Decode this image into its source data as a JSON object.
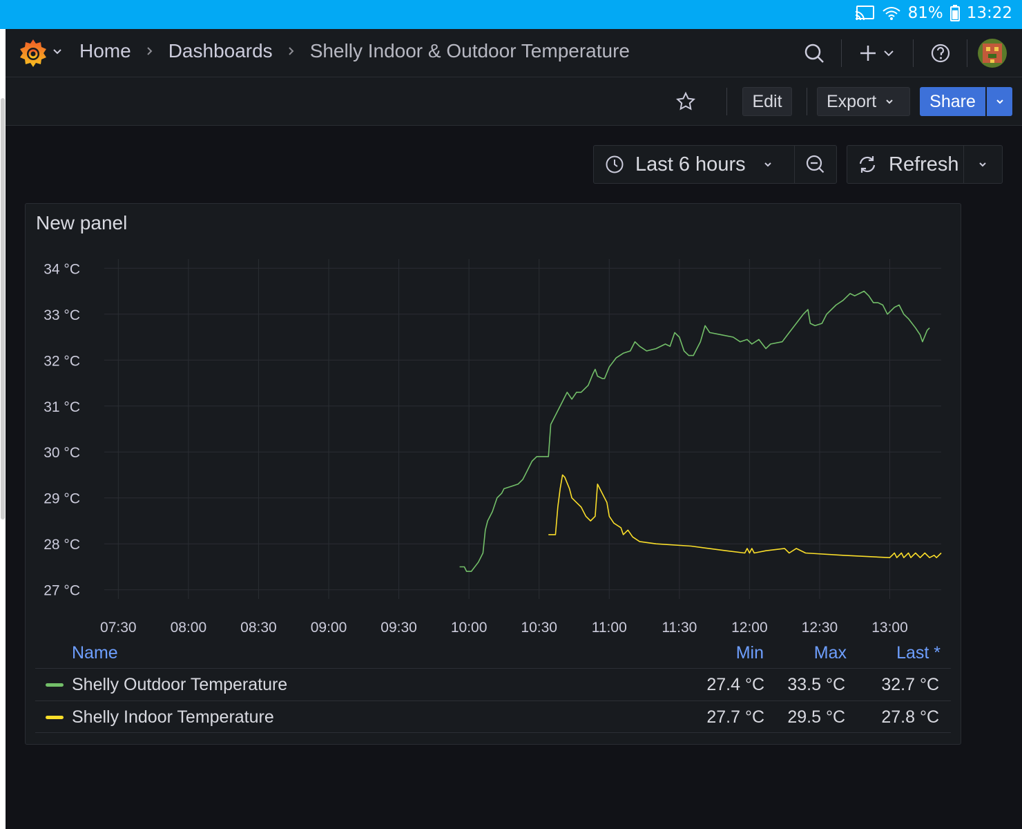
{
  "status_bar": {
    "battery": "81%",
    "time": "13:22"
  },
  "nav": {
    "breadcrumb": [
      "Home",
      "Dashboards",
      "Shelly Indoor & Outdoor Temperature"
    ]
  },
  "toolbar": {
    "edit": "Edit",
    "export": "Export",
    "share": "Share"
  },
  "timepicker": {
    "range": "Last 6 hours",
    "refresh": "Refresh"
  },
  "panel": {
    "title": "New panel",
    "legend": {
      "headers": {
        "name": "Name",
        "min": "Min",
        "max": "Max",
        "last": "Last *"
      },
      "rows": [
        {
          "name": "Shelly Outdoor Temperature",
          "min": "27.4 °C",
          "max": "33.5 °C",
          "last": "32.7 °C",
          "color": "#73bf69"
        },
        {
          "name": "Shelly Indoor Temperature",
          "min": "27.7 °C",
          "max": "29.5 °C",
          "last": "27.8 °C",
          "color": "#fade2a"
        }
      ]
    }
  },
  "chart_data": {
    "type": "line",
    "x_ticks": [
      "07:30",
      "08:00",
      "08:30",
      "09:00",
      "09:30",
      "10:00",
      "10:30",
      "11:00",
      "11:30",
      "12:00",
      "12:30",
      "13:00"
    ],
    "y_ticks": [
      "34 °C",
      "33 °C",
      "32 °C",
      "31 °C",
      "30 °C",
      "29 °C",
      "28 °C",
      "27 °C"
    ],
    "ylim": [
      27,
      34
    ],
    "xlim": [
      "07:30",
      "13:22"
    ],
    "grid": true,
    "series": [
      {
        "name": "Shelly Outdoor Temperature",
        "color": "#73bf69",
        "points": [
          [
            "09:56",
            27.5
          ],
          [
            "09:58",
            27.5
          ],
          [
            "09:59",
            27.4
          ],
          [
            "10:01",
            27.4
          ],
          [
            "10:04",
            27.6
          ],
          [
            "10:06",
            27.8
          ],
          [
            "10:07",
            28.3
          ],
          [
            "10:08",
            28.5
          ],
          [
            "10:10",
            28.7
          ],
          [
            "10:12",
            29.0
          ],
          [
            "10:14",
            29.1
          ],
          [
            "10:15",
            29.2
          ],
          [
            "10:18",
            29.25
          ],
          [
            "10:21",
            29.3
          ],
          [
            "10:23",
            29.4
          ],
          [
            "10:25",
            29.6
          ],
          [
            "10:27",
            29.8
          ],
          [
            "10:29",
            29.9
          ],
          [
            "10:32",
            29.9
          ],
          [
            "10:34",
            29.9
          ],
          [
            "10:35",
            30.6
          ],
          [
            "10:37",
            30.8
          ],
          [
            "10:40",
            31.1
          ],
          [
            "10:42",
            31.3
          ],
          [
            "10:44",
            31.15
          ],
          [
            "10:46",
            31.3
          ],
          [
            "10:48",
            31.3
          ],
          [
            "10:51",
            31.45
          ],
          [
            "10:53",
            31.7
          ],
          [
            "10:54",
            31.8
          ],
          [
            "10:55",
            31.65
          ],
          [
            "10:57",
            31.6
          ],
          [
            "10:58",
            31.6
          ],
          [
            "11:00",
            31.85
          ],
          [
            "11:03",
            32.05
          ],
          [
            "11:06",
            32.15
          ],
          [
            "11:09",
            32.2
          ],
          [
            "11:11",
            32.4
          ],
          [
            "11:13",
            32.3
          ],
          [
            "11:16",
            32.2
          ],
          [
            "11:20",
            32.25
          ],
          [
            "11:24",
            32.35
          ],
          [
            "11:26",
            32.3
          ],
          [
            "11:28",
            32.6
          ],
          [
            "11:30",
            32.5
          ],
          [
            "11:32",
            32.2
          ],
          [
            "11:34",
            32.1
          ],
          [
            "11:36",
            32.1
          ],
          [
            "11:39",
            32.4
          ],
          [
            "11:41",
            32.75
          ],
          [
            "11:43",
            32.6
          ],
          [
            "11:48",
            32.55
          ],
          [
            "11:53",
            32.5
          ],
          [
            "11:56",
            32.4
          ],
          [
            "11:59",
            32.45
          ],
          [
            "12:01",
            32.35
          ],
          [
            "12:04",
            32.45
          ],
          [
            "12:07",
            32.25
          ],
          [
            "12:09",
            32.35
          ],
          [
            "12:14",
            32.4
          ],
          [
            "12:17",
            32.6
          ],
          [
            "12:20",
            32.8
          ],
          [
            "12:23",
            33.0
          ],
          [
            "12:25",
            33.1
          ],
          [
            "12:26",
            32.8
          ],
          [
            "12:28",
            32.75
          ],
          [
            "12:31",
            32.8
          ],
          [
            "12:33",
            33.0
          ],
          [
            "12:37",
            33.2
          ],
          [
            "12:40",
            33.3
          ],
          [
            "12:43",
            33.45
          ],
          [
            "12:45",
            33.4
          ],
          [
            "12:47",
            33.45
          ],
          [
            "12:49",
            33.5
          ],
          [
            "12:51",
            33.4
          ],
          [
            "12:53",
            33.25
          ],
          [
            "12:55",
            33.25
          ],
          [
            "12:57",
            33.2
          ],
          [
            "12:59",
            33.0
          ],
          [
            "13:02",
            33.15
          ],
          [
            "13:04",
            33.2
          ],
          [
            "13:06",
            33.0
          ],
          [
            "13:08",
            32.9
          ],
          [
            "13:11",
            32.7
          ],
          [
            "13:13",
            32.55
          ],
          [
            "13:14",
            32.4
          ],
          [
            "13:16",
            32.65
          ],
          [
            "13:17",
            32.7
          ]
        ]
      },
      {
        "name": "Shelly Indoor Temperature",
        "color": "#fade2a",
        "points": [
          [
            "10:34",
            28.2
          ],
          [
            "10:37",
            28.2
          ],
          [
            "10:38",
            28.8
          ],
          [
            "10:39",
            29.2
          ],
          [
            "10:40",
            29.5
          ],
          [
            "10:41",
            29.45
          ],
          [
            "10:43",
            29.2
          ],
          [
            "10:44",
            29.0
          ],
          [
            "10:46",
            28.9
          ],
          [
            "10:48",
            28.8
          ],
          [
            "10:49",
            28.7
          ],
          [
            "10:50",
            28.6
          ],
          [
            "10:52",
            28.5
          ],
          [
            "10:54",
            28.6
          ],
          [
            "10:55",
            29.3
          ],
          [
            "10:57",
            29.1
          ],
          [
            "10:59",
            28.9
          ],
          [
            "11:00",
            28.6
          ],
          [
            "11:02",
            28.45
          ],
          [
            "11:05",
            28.35
          ],
          [
            "11:06",
            28.2
          ],
          [
            "11:08",
            28.3
          ],
          [
            "11:10",
            28.15
          ],
          [
            "11:13",
            28.05
          ],
          [
            "11:20",
            28.0
          ],
          [
            "11:35",
            27.95
          ],
          [
            "11:50",
            27.85
          ],
          [
            "11:58",
            27.8
          ],
          [
            "11:59",
            27.9
          ],
          [
            "12:00",
            27.8
          ],
          [
            "12:01",
            27.9
          ],
          [
            "12:02",
            27.8
          ],
          [
            "12:07",
            27.85
          ],
          [
            "12:15",
            27.9
          ],
          [
            "12:17",
            27.8
          ],
          [
            "12:20",
            27.9
          ],
          [
            "12:24",
            27.8
          ],
          [
            "12:40",
            27.75
          ],
          [
            "13:00",
            27.7
          ],
          [
            "13:02",
            27.8
          ],
          [
            "13:03",
            27.7
          ],
          [
            "13:05",
            27.8
          ],
          [
            "13:06",
            27.7
          ],
          [
            "13:08",
            27.8
          ],
          [
            "13:09",
            27.7
          ],
          [
            "13:11",
            27.8
          ],
          [
            "13:13",
            27.7
          ],
          [
            "13:15",
            27.8
          ],
          [
            "13:17",
            27.7
          ],
          [
            "13:19",
            27.75
          ],
          [
            "13:20",
            27.7
          ],
          [
            "13:22",
            27.8
          ]
        ]
      }
    ]
  }
}
